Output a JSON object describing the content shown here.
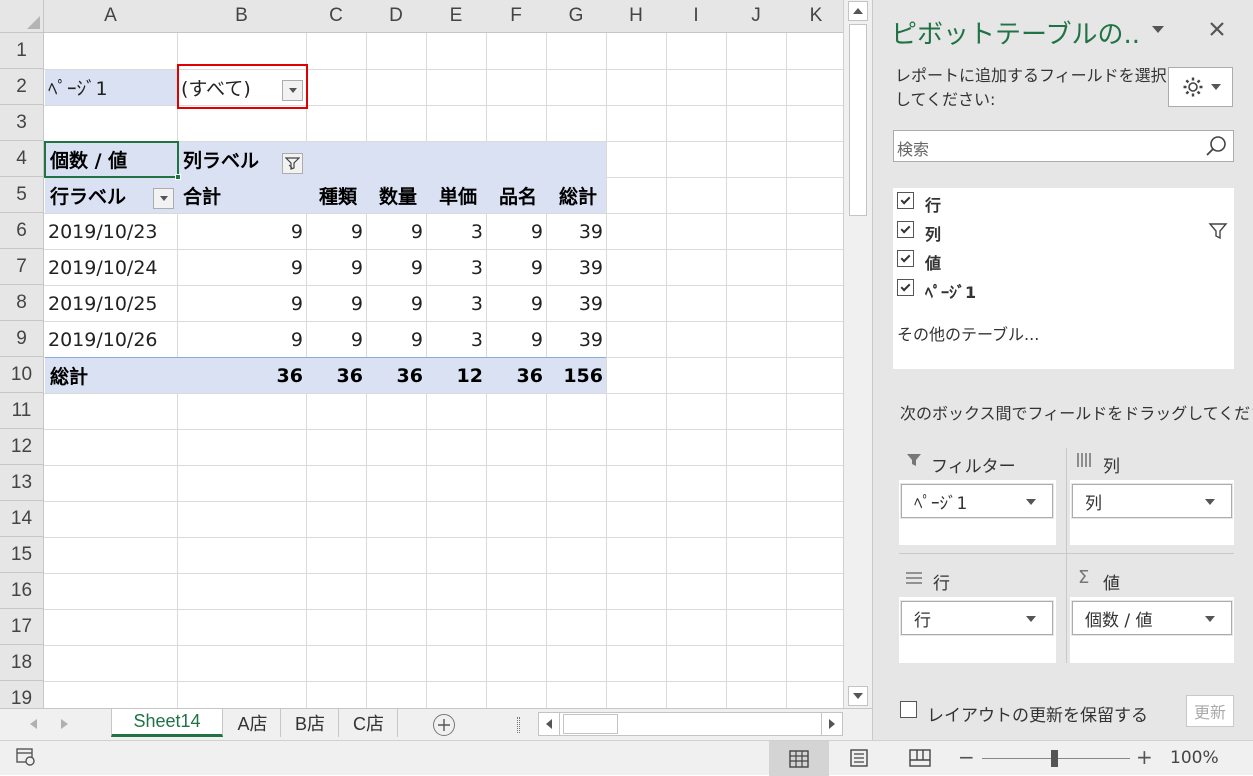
{
  "columns": [
    "A",
    "B",
    "C",
    "D",
    "E",
    "F",
    "G",
    "H",
    "I",
    "J",
    "K"
  ],
  "rows": [
    "1",
    "2",
    "3",
    "4",
    "5",
    "6",
    "7",
    "8",
    "9",
    "10",
    "11",
    "12",
    "13",
    "14",
    "15",
    "16",
    "17",
    "18",
    "19"
  ],
  "pivot": {
    "page_label": "ﾍﾟｰｼﾞ1",
    "page_value": "(すべて)",
    "values_header": "個数 / 値",
    "col_labels_header": "列ラベル",
    "row_labels_header": "行ラベル",
    "col_headers": [
      "合計",
      "種類",
      "数量",
      "単価",
      "品名",
      "総計"
    ],
    "data_rows": [
      {
        "label": "2019/10/23",
        "values": [
          "9",
          "9",
          "9",
          "3",
          "9",
          "39"
        ]
      },
      {
        "label": "2019/10/24",
        "values": [
          "9",
          "9",
          "9",
          "3",
          "9",
          "39"
        ]
      },
      {
        "label": "2019/10/25",
        "values": [
          "9",
          "9",
          "9",
          "3",
          "9",
          "39"
        ]
      },
      {
        "label": "2019/10/26",
        "values": [
          "9",
          "9",
          "9",
          "3",
          "9",
          "39"
        ]
      }
    ],
    "total_label": "総計",
    "total_values": [
      "36",
      "36",
      "36",
      "12",
      "36",
      "156"
    ]
  },
  "sheet_tabs": [
    "Sheet14",
    "A店",
    "B店",
    "C店"
  ],
  "active_tab": "Sheet14",
  "pane": {
    "title": "ピボットテーブルの..",
    "instruction": "レポートに追加するフィールドを選択\nしてください:",
    "search_placeholder": "検索",
    "fields": [
      {
        "label": "行",
        "checked": true
      },
      {
        "label": "列",
        "checked": true
      },
      {
        "label": "値",
        "checked": true
      },
      {
        "label": "ﾍﾟｰｼﾞ1",
        "checked": true
      }
    ],
    "more_tables": "その他のテーブル...",
    "drag_instruction": "次のボックス間でフィールドをドラッグしてください:",
    "areas": {
      "filter": {
        "label": "フィルター",
        "item": "ﾍﾟｰｼﾞ1"
      },
      "columns": {
        "label": "列",
        "item": "列"
      },
      "rows": {
        "label": "行",
        "item": "行"
      },
      "values": {
        "label": "値",
        "item": "個数 / 値"
      }
    },
    "defer_label": "レイアウトの更新を保留する",
    "update_label": "更新"
  },
  "status": {
    "zoom": "100%"
  }
}
